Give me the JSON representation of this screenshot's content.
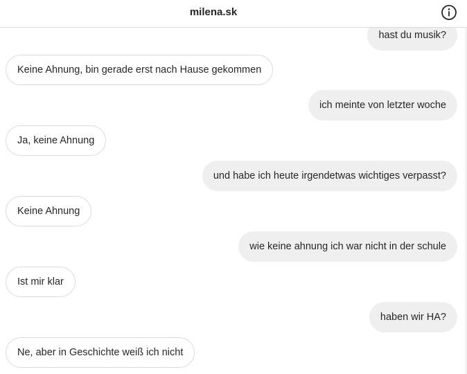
{
  "header": {
    "title": "milena.sk",
    "info_icon": "info-circle-icon"
  },
  "messages": [
    {
      "sender": "me",
      "text": "hast du musik?"
    },
    {
      "sender": "them",
      "text": "Keine Ahnung, bin gerade erst nach Hause gekommen"
    },
    {
      "sender": "me",
      "text": "ich meinte von letzter woche"
    },
    {
      "sender": "them",
      "text": "Ja, keine Ahnung"
    },
    {
      "sender": "me",
      "text": "und habe ich heute irgendetwas wichtiges verpasst?"
    },
    {
      "sender": "them",
      "text": "Keine Ahnung"
    },
    {
      "sender": "me",
      "text": "wie keine ahnung ich war nicht in der schule"
    },
    {
      "sender": "them",
      "text": "Ist mir klar"
    },
    {
      "sender": "me",
      "text": "haben wir HA?"
    },
    {
      "sender": "them",
      "text": "Ne, aber in Geschichte weiß ich nicht"
    }
  ],
  "colors": {
    "outgoing_bubble": "#efefef",
    "incoming_border": "#dbdbdb",
    "text": "#262626"
  }
}
